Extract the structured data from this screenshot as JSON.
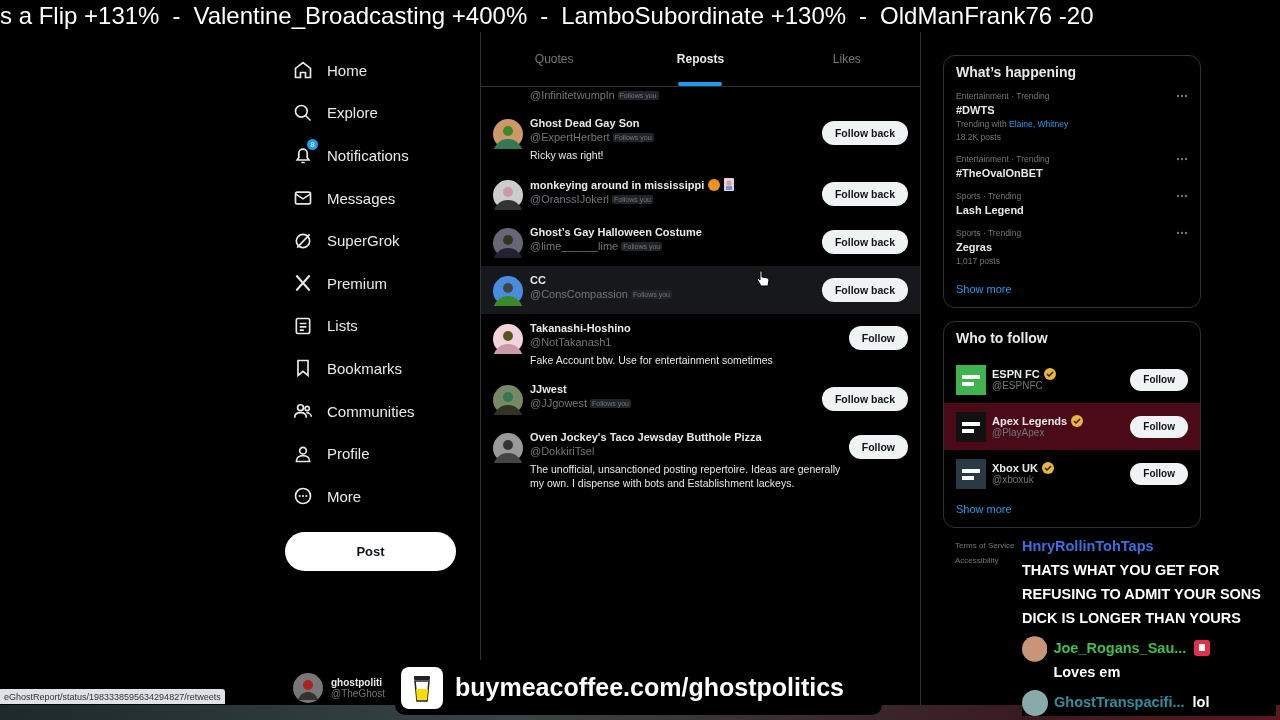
{
  "ticker": {
    "separator": "-",
    "items": [
      "s a Flip +131%",
      "Valentine_Broadcasting +400%",
      "LamboSubordinate +130%",
      "OldManFrank76 -20"
    ]
  },
  "nav": {
    "items": [
      {
        "kind": "home",
        "label": "Home"
      },
      {
        "kind": "explore",
        "label": "Explore"
      },
      {
        "kind": "notifications",
        "label": "Notifications",
        "badge": "8"
      },
      {
        "kind": "messages",
        "label": "Messages"
      },
      {
        "kind": "grok",
        "label": "SuperGrok"
      },
      {
        "kind": "premium",
        "label": "Premium"
      },
      {
        "kind": "lists",
        "label": "Lists"
      },
      {
        "kind": "bookmarks",
        "label": "Bookmarks"
      },
      {
        "kind": "communities",
        "label": "Communities"
      },
      {
        "kind": "profile",
        "label": "Profile"
      },
      {
        "kind": "more",
        "label": "More"
      }
    ],
    "post_button": "Post",
    "account": {
      "name": "ghostpoliti",
      "handle": "@TheGhost"
    }
  },
  "tabs": [
    {
      "label": "Quotes",
      "selected": false
    },
    {
      "label": "Reposts",
      "selected": true
    },
    {
      "label": "Likes",
      "selected": false
    }
  ],
  "users": [
    {
      "kind": "partial",
      "handle": "@Infinitetwumpln",
      "follows_label": "Follows you"
    },
    {
      "kind": "full",
      "name": "Ghost Dead Gay Son",
      "handle": "@ExpertHerbert",
      "follows_label": "Follows you",
      "bio": "Ricky was right!",
      "button": "Follow back",
      "hovered": false
    },
    {
      "kind": "full",
      "name": "monkeying around in mississippi",
      "emoji": true,
      "handle": "@OranssIJokerl",
      "follows_label": "Follows you",
      "button": "Follow back",
      "hovered": false
    },
    {
      "kind": "full",
      "name": "Ghost’s Gay Halloween Costume",
      "handle": "@lime______lime",
      "follows_label": "Follows you",
      "button": "Follow back",
      "hovered": false
    },
    {
      "kind": "full",
      "name": "CC",
      "handle": "@ConsCompassion",
      "follows_label": "Follows you",
      "button": "Follow back",
      "hovered": true
    },
    {
      "kind": "full",
      "name": "Takanashi-Hoshino",
      "handle": "@NotTakanash1",
      "bio": "Fake Account btw. Use for entertainment sometimes",
      "button": "Follow",
      "hovered": false
    },
    {
      "kind": "full",
      "name": "JJwest",
      "handle": "@JJgowest",
      "follows_label": "Follows you",
      "button": "Follow back",
      "hovered": false
    },
    {
      "kind": "full",
      "name": "Oven Jockey's Taco Jewsday Butthole Pizza",
      "handle": "@DokkiriTsel",
      "bio": "The unofficial, unsanctioned posting repertoire. Ideas are generally my own. I dispense with bots and Establishment lackeys.",
      "button": "Follow",
      "hovered": false
    }
  ],
  "trends": {
    "title": "What’s happening",
    "items": [
      {
        "category": "Entertainment · Trending",
        "title": "#DWTS",
        "with_label": "Trending with",
        "with_links": "Elaine, Whitney",
        "posts": "18.2K posts"
      },
      {
        "category": "Entertainment · Trending",
        "title": "#TheOvalOnBET"
      },
      {
        "category": "Sports · Trending",
        "title": "Lash Legend"
      },
      {
        "category": "Sports · Trending",
        "title": "Zegras",
        "posts": "1,017 posts"
      }
    ],
    "show_more": "Show more"
  },
  "who_to_follow": {
    "title": "Who to follow",
    "items": [
      {
        "name": "ESPN FC",
        "handle": "@ESPNFC",
        "button": "Follow",
        "highlighted": false
      },
      {
        "name": "Apex Legends",
        "handle": "@PlayApex",
        "button": "Follow",
        "highlighted": true
      },
      {
        "name": "Xbox UK",
        "handle": "@xboxuk",
        "button": "Follow",
        "highlighted": false
      }
    ],
    "show_more": "Show more"
  },
  "footer": [
    "Terms of Service",
    "Accessibility"
  ],
  "chat": [
    {
      "user": "HnryRollinTohTaps",
      "color": "#3b6fe0",
      "text": "THATS WHAT YOU GET FOR REFUSING TO ADMIT YOUR SONS DICK IS LONGER THAN YOURS",
      "badge": false
    },
    {
      "user": "Joe_Rogans_Sau...",
      "color": "#3fbf4f",
      "text": "Loves em",
      "badge": true
    },
    {
      "user": "GhostTranspacifi...",
      "color": "#2f8fa0",
      "text": "lol",
      "badge": false
    }
  ],
  "status_url": "eGhostReport/status/1983338595634294827/retweets",
  "banner": "buymeacoffee.com/ghostpolitics"
}
